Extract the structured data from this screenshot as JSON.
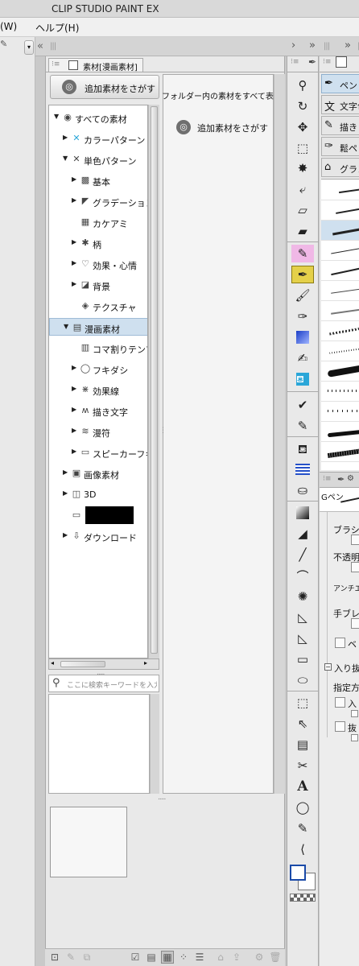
{
  "window": {
    "title": "CLIP STUDIO PAINT EX"
  },
  "menu": {
    "items": [
      "(W)",
      "ヘルプ(H)"
    ]
  },
  "material_panel": {
    "tab_label": "素材[漫画素材]",
    "find_more_button": "追加素材をさがす",
    "show_all_label": "フォルダー内の素材をすべて表示",
    "find_more_link": "追加素材をさがす",
    "search_placeholder": "ここに検索キーワードを入力し",
    "tree": [
      {
        "label": "すべての素材",
        "level": 0,
        "expanded": true,
        "icon": "all-materials-icon"
      },
      {
        "label": "カラーパターン",
        "level": 1,
        "expanded": false,
        "icon": "color-pattern-icon"
      },
      {
        "label": "単色パターン",
        "level": 1,
        "expanded": true,
        "icon": "mono-pattern-icon"
      },
      {
        "label": "基本",
        "level": 2,
        "expanded": false,
        "icon": "checker-icon"
      },
      {
        "label": "グラデーション",
        "level": 2,
        "expanded": false,
        "icon": "gradient-icon"
      },
      {
        "label": "カケアミ",
        "level": 2,
        "expanded": null,
        "icon": "hatch-icon"
      },
      {
        "label": "柄",
        "level": 2,
        "expanded": false,
        "icon": "pattern-icon"
      },
      {
        "label": "効果・心情",
        "level": 2,
        "expanded": false,
        "icon": "heart-icon"
      },
      {
        "label": "背景",
        "level": 2,
        "expanded": false,
        "icon": "background-icon"
      },
      {
        "label": "テクスチャ",
        "level": 2,
        "expanded": null,
        "icon": "texture-icon"
      },
      {
        "label": "漫画素材",
        "level": 1,
        "expanded": true,
        "icon": "manga-material-icon",
        "selected": true
      },
      {
        "label": "コマ割りテンプレ",
        "level": 2,
        "expanded": null,
        "icon": "frame-template-icon"
      },
      {
        "label": "フキダシ",
        "level": 2,
        "expanded": false,
        "icon": "balloon-icon"
      },
      {
        "label": "効果線",
        "level": 2,
        "expanded": false,
        "icon": "effect-line-icon"
      },
      {
        "label": "描き文字",
        "level": 2,
        "expanded": false,
        "icon": "drawn-text-icon"
      },
      {
        "label": "漫符",
        "level": 2,
        "expanded": false,
        "icon": "manpu-icon"
      },
      {
        "label": "スピーカーフキダ",
        "level": 2,
        "expanded": false,
        "icon": "folder-icon"
      },
      {
        "label": "画像素材",
        "level": 1,
        "expanded": false,
        "icon": "image-material-icon"
      },
      {
        "label": "3D",
        "level": 1,
        "expanded": false,
        "icon": "3d-icon"
      },
      {
        "label": "",
        "level": 1,
        "expanded": null,
        "icon": "folder-icon",
        "redacted": true
      },
      {
        "label": "ダウンロード",
        "level": 1,
        "expanded": false,
        "icon": "download-icon"
      }
    ]
  },
  "subtool_panel": {
    "groups": [
      "ペン",
      "文字色",
      "描き",
      "鬆ペ",
      "グラン"
    ],
    "detail_label": "Gペン",
    "properties": [
      "ブラシサ",
      "不透明",
      "アンチエイ",
      "手ブレ",
      "ベ",
      "入り抜",
      "指定方",
      "入",
      "抜"
    ]
  },
  "colors": {
    "selection": "#cfe0ef",
    "active_tool": "#e4d04a"
  }
}
